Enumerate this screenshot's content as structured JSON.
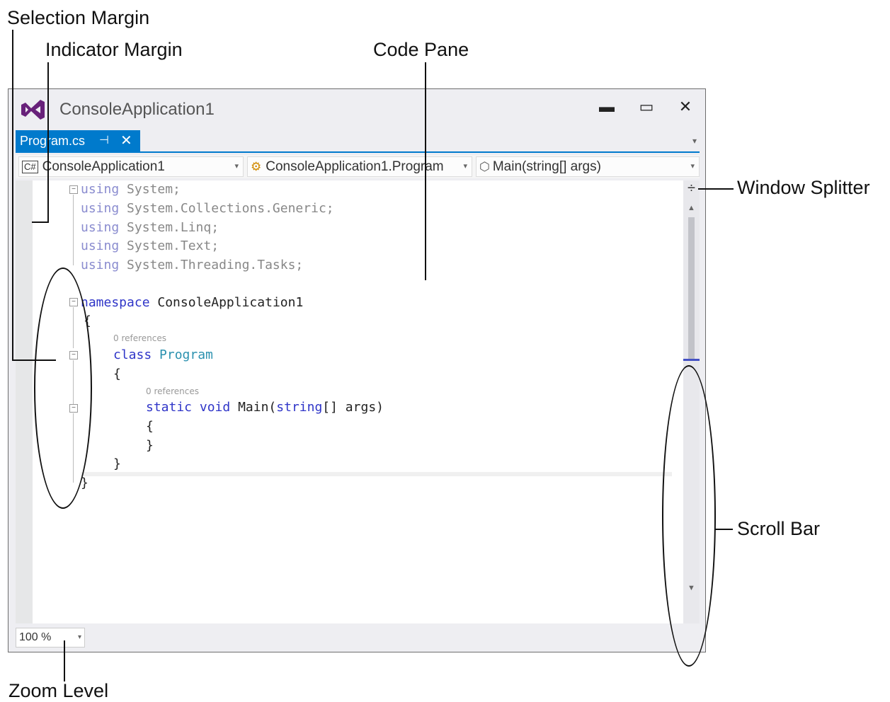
{
  "callouts": {
    "selection_margin": "Selection Margin",
    "indicator_margin": "Indicator Margin",
    "code_pane": "Code Pane",
    "window_splitter": "Window Splitter",
    "scroll_bar": "Scroll Bar",
    "zoom_level": "Zoom Level"
  },
  "window": {
    "title": "ConsoleApplication1",
    "minimize_glyph": "▬",
    "maximize_glyph": "▭",
    "close_glyph": "✕"
  },
  "tabs": [
    {
      "label": "Program.cs",
      "pin_glyph": "⊣",
      "close_glyph": "✕"
    }
  ],
  "tab_overflow_glyph": "▾",
  "navbar": {
    "project": {
      "icon": "C#",
      "label": "ConsoleApplication1"
    },
    "class": {
      "icon": "class-icon",
      "label": "ConsoleApplication1.Program"
    },
    "member": {
      "icon": "method-icon",
      "label": "Main(string[] args)"
    },
    "dropdown_glyph": "▾"
  },
  "code": {
    "lines": [
      {
        "kw": "using",
        "rest": " System;"
      },
      {
        "kw": "using",
        "rest": " System.Collections.Generic;"
      },
      {
        "kw": "using",
        "rest": " System.Linq;"
      },
      {
        "kw": "using",
        "rest": " System.Text;"
      },
      {
        "kw": "using",
        "rest": " System.Threading.Tasks;"
      }
    ],
    "namespace_kw": "namespace",
    "namespace_name": " ConsoleApplication1",
    "open_brace": "{",
    "close_brace": "}",
    "class_refs": "0 references",
    "class_kw": "class",
    "class_name": "Program",
    "method_refs": "0 references",
    "method_kw1": "static",
    "method_kw2": "void",
    "method_name": "Main(",
    "method_param_kw": "string",
    "method_params": "[] args)"
  },
  "scrollbar": {
    "splitter_glyph": "÷",
    "up_glyph": "▲",
    "down_glyph": "▼"
  },
  "status": {
    "zoom_value": "100 %",
    "zoom_dropdown": "▾"
  },
  "colors": {
    "accent": "#007acc",
    "keyword": "#2f35c8",
    "type": "#2b91af"
  }
}
